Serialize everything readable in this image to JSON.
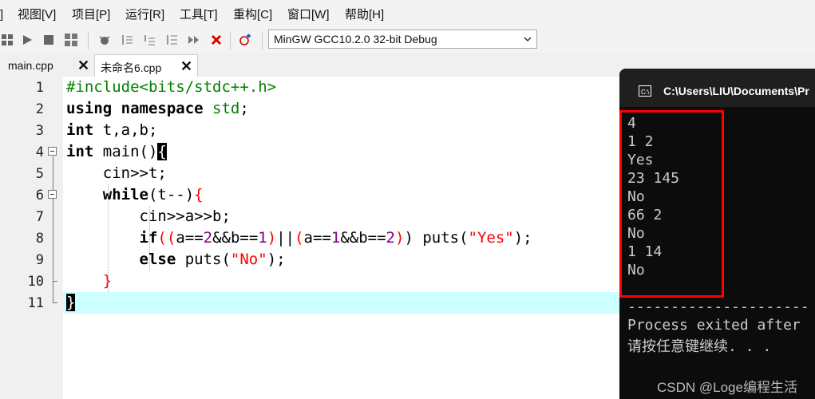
{
  "menu": [
    "视图[V]",
    "项目[P]",
    "运行[R]",
    "工具[T]",
    "重构[C]",
    "窗口[W]",
    "帮助[H]"
  ],
  "toolbar": {
    "compiler": "MinGW GCC10.2.0 32-bit Debug"
  },
  "tabs": [
    {
      "label": "main.cpp",
      "close": "✕"
    },
    {
      "label": "未命名6.cpp",
      "close": "✕"
    }
  ],
  "editor": {
    "line_numbers": [
      "1",
      "2",
      "3",
      "4",
      "5",
      "6",
      "7",
      "8",
      "9",
      "10",
      "11"
    ]
  },
  "console": {
    "title": "C:\\Users\\LIU\\Documents\\Pr",
    "output": [
      "4",
      "1 2",
      "Yes",
      "23 145",
      "No",
      "66 2",
      "No",
      "1 14",
      "No"
    ],
    "separator": "---------------------",
    "exit_line": "Process exited after",
    "pause_line": "请按任意键继续. . ."
  },
  "watermark": "CSDN @Loge编程生活"
}
